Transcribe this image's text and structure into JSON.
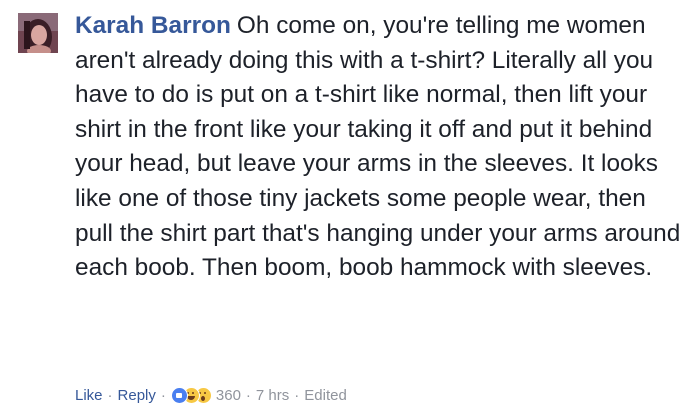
{
  "comment": {
    "author": "Karah Barron",
    "text": "Oh come on, you're telling me women aren't already doing this with a t-shirt? Literally all you have to do is put on a t-shirt like normal, then lift your shirt in the front like your taking it off and put it behind your head, but leave your arms in the sleeves. It looks like one of those tiny jackets some people wear, then pull the shirt part that's hanging under your arms around each boob. Then boom, boob hammock with sleeves."
  },
  "actions": {
    "like_label": "Like",
    "reply_label": "Reply",
    "separator": "·",
    "reactions": [
      "like-icon",
      "haha-icon",
      "wow-icon"
    ],
    "reaction_count": "360",
    "time": "7 hrs",
    "edited_label": "Edited"
  },
  "colors": {
    "author_link": "#365899",
    "text": "#1d2129",
    "meta": "#90949c",
    "like_reaction": "#4a7ff0",
    "emoji_yellow": "#f7c844"
  }
}
